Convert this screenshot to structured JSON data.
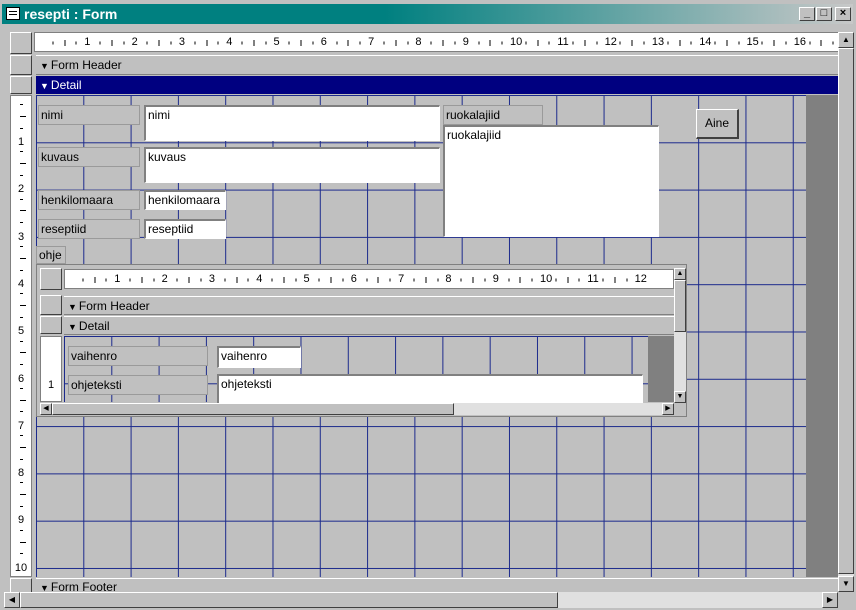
{
  "window": {
    "title": "resepti : Form",
    "buttons": [
      "_",
      "□",
      "×"
    ]
  },
  "ruler": {
    "h_numbers": [
      "1",
      "2",
      "3",
      "4",
      "5",
      "6",
      "7",
      "8",
      "9",
      "10",
      "11",
      "12",
      "13",
      "14",
      "15",
      "16",
      "1"
    ],
    "v_numbers": [
      "1",
      "2",
      "3",
      "4",
      "5",
      "6",
      "7",
      "8",
      "9",
      "10"
    ]
  },
  "sections": {
    "form_header": "Form Header",
    "detail": "Detail",
    "form_footer": "Form Footer"
  },
  "fields": {
    "nimi": {
      "label": "nimi",
      "value": "nimi"
    },
    "kuvaus": {
      "label": "kuvaus",
      "value": "kuvaus"
    },
    "henkilomaara": {
      "label": "henkilomaara",
      "value": "henkilomaara"
    },
    "reseptiid": {
      "label": "reseptiid",
      "value": "reseptiid"
    },
    "ruokalajiid": {
      "label": "ruokalajiid",
      "value": "ruokalajiid"
    }
  },
  "aine_button": "Aine",
  "subform": {
    "label": "ohje",
    "ruler_numbers": [
      "1",
      "2",
      "3",
      "4",
      "5",
      "6",
      "7",
      "8",
      "9",
      "10",
      "11",
      "12"
    ],
    "v_numbers": [
      "1"
    ],
    "form_header": "Form Header",
    "detail": "Detail",
    "fields": {
      "vaihenro": {
        "label": "vaihenro",
        "value": "vaihenro"
      },
      "ohjeteksti": {
        "label": "ohjeteksti",
        "value": "ohjeteksti"
      }
    }
  },
  "colors": {
    "title_bar": "#008080",
    "grid": "#1c2a8c",
    "selected_band": "#000080"
  }
}
